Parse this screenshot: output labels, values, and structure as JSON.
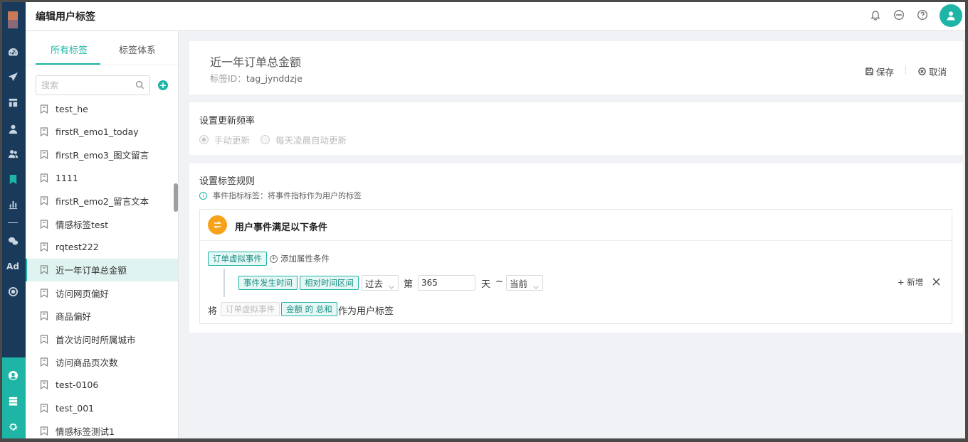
{
  "header": {
    "title": "编辑用户标签",
    "icons": [
      "bell-icon",
      "chat-icon",
      "help-icon",
      "user-avatar-icon"
    ]
  },
  "sidebar_rail": {
    "icons": [
      "dashboard-icon",
      "send-icon",
      "layout-icon",
      "user-icon",
      "users-icon",
      "bookmark-icon",
      "bar-chart-icon",
      "wechat-icon",
      "ad-icon",
      "target-icon",
      "profile-icon",
      "server-icon",
      "settings-icon"
    ],
    "ad_label": "Ad",
    "accent": "#1fb5a6"
  },
  "panel": {
    "tabs": [
      {
        "label": "所有标签",
        "active": true
      },
      {
        "label": "标签体系",
        "active": false
      }
    ],
    "search_placeholder": "搜索",
    "add_icon": "+",
    "items": [
      {
        "label": "test_he"
      },
      {
        "label": "firstR_emo1_today"
      },
      {
        "label": "firstR_emo3_图文留言"
      },
      {
        "label": "1111"
      },
      {
        "label": "firstR_emo2_留言文本"
      },
      {
        "label": "情感标签test"
      },
      {
        "label": "rqtest222"
      },
      {
        "label": "近一年订单总金额",
        "active": true
      },
      {
        "label": "访问网页偏好"
      },
      {
        "label": "商品偏好"
      },
      {
        "label": "首次访问时所属城市"
      },
      {
        "label": "访问商品页次数"
      },
      {
        "label": "test-0106"
      },
      {
        "label": "test_001"
      },
      {
        "label": "情感标签测试1"
      }
    ]
  },
  "tag_info": {
    "name": "近一年订单总金额",
    "id_label": "标签ID：",
    "id_value": "tag_jynddzje",
    "save_label": "保存",
    "cancel_label": "取消"
  },
  "frequency": {
    "title": "设置更新频率",
    "options": [
      {
        "label": "手动更新",
        "selected": true
      },
      {
        "label": "每天凌晨自动更新",
        "selected": false
      }
    ]
  },
  "rules": {
    "title": "设置标签规则",
    "hint_icon": "i",
    "hint": "事件指标标签：将事件指标作为用户的标签",
    "condition_title": "用户事件满足以下条件",
    "event_tag": "订单虚拟事件",
    "add_attr": "添加属性条件",
    "add_attr_icon": "+",
    "filter": {
      "field": "事件发生时间",
      "mode": "相对时间区间",
      "direction": "过去",
      "prefix": "第",
      "value": "365",
      "unit": "天",
      "tilde": "~",
      "end": "当前"
    },
    "new_label": "+ 新增",
    "result": {
      "prefix": "将",
      "event": "订单虚拟事件",
      "metric": "金额 的 总和",
      "suffix": "作为用户标签"
    }
  }
}
